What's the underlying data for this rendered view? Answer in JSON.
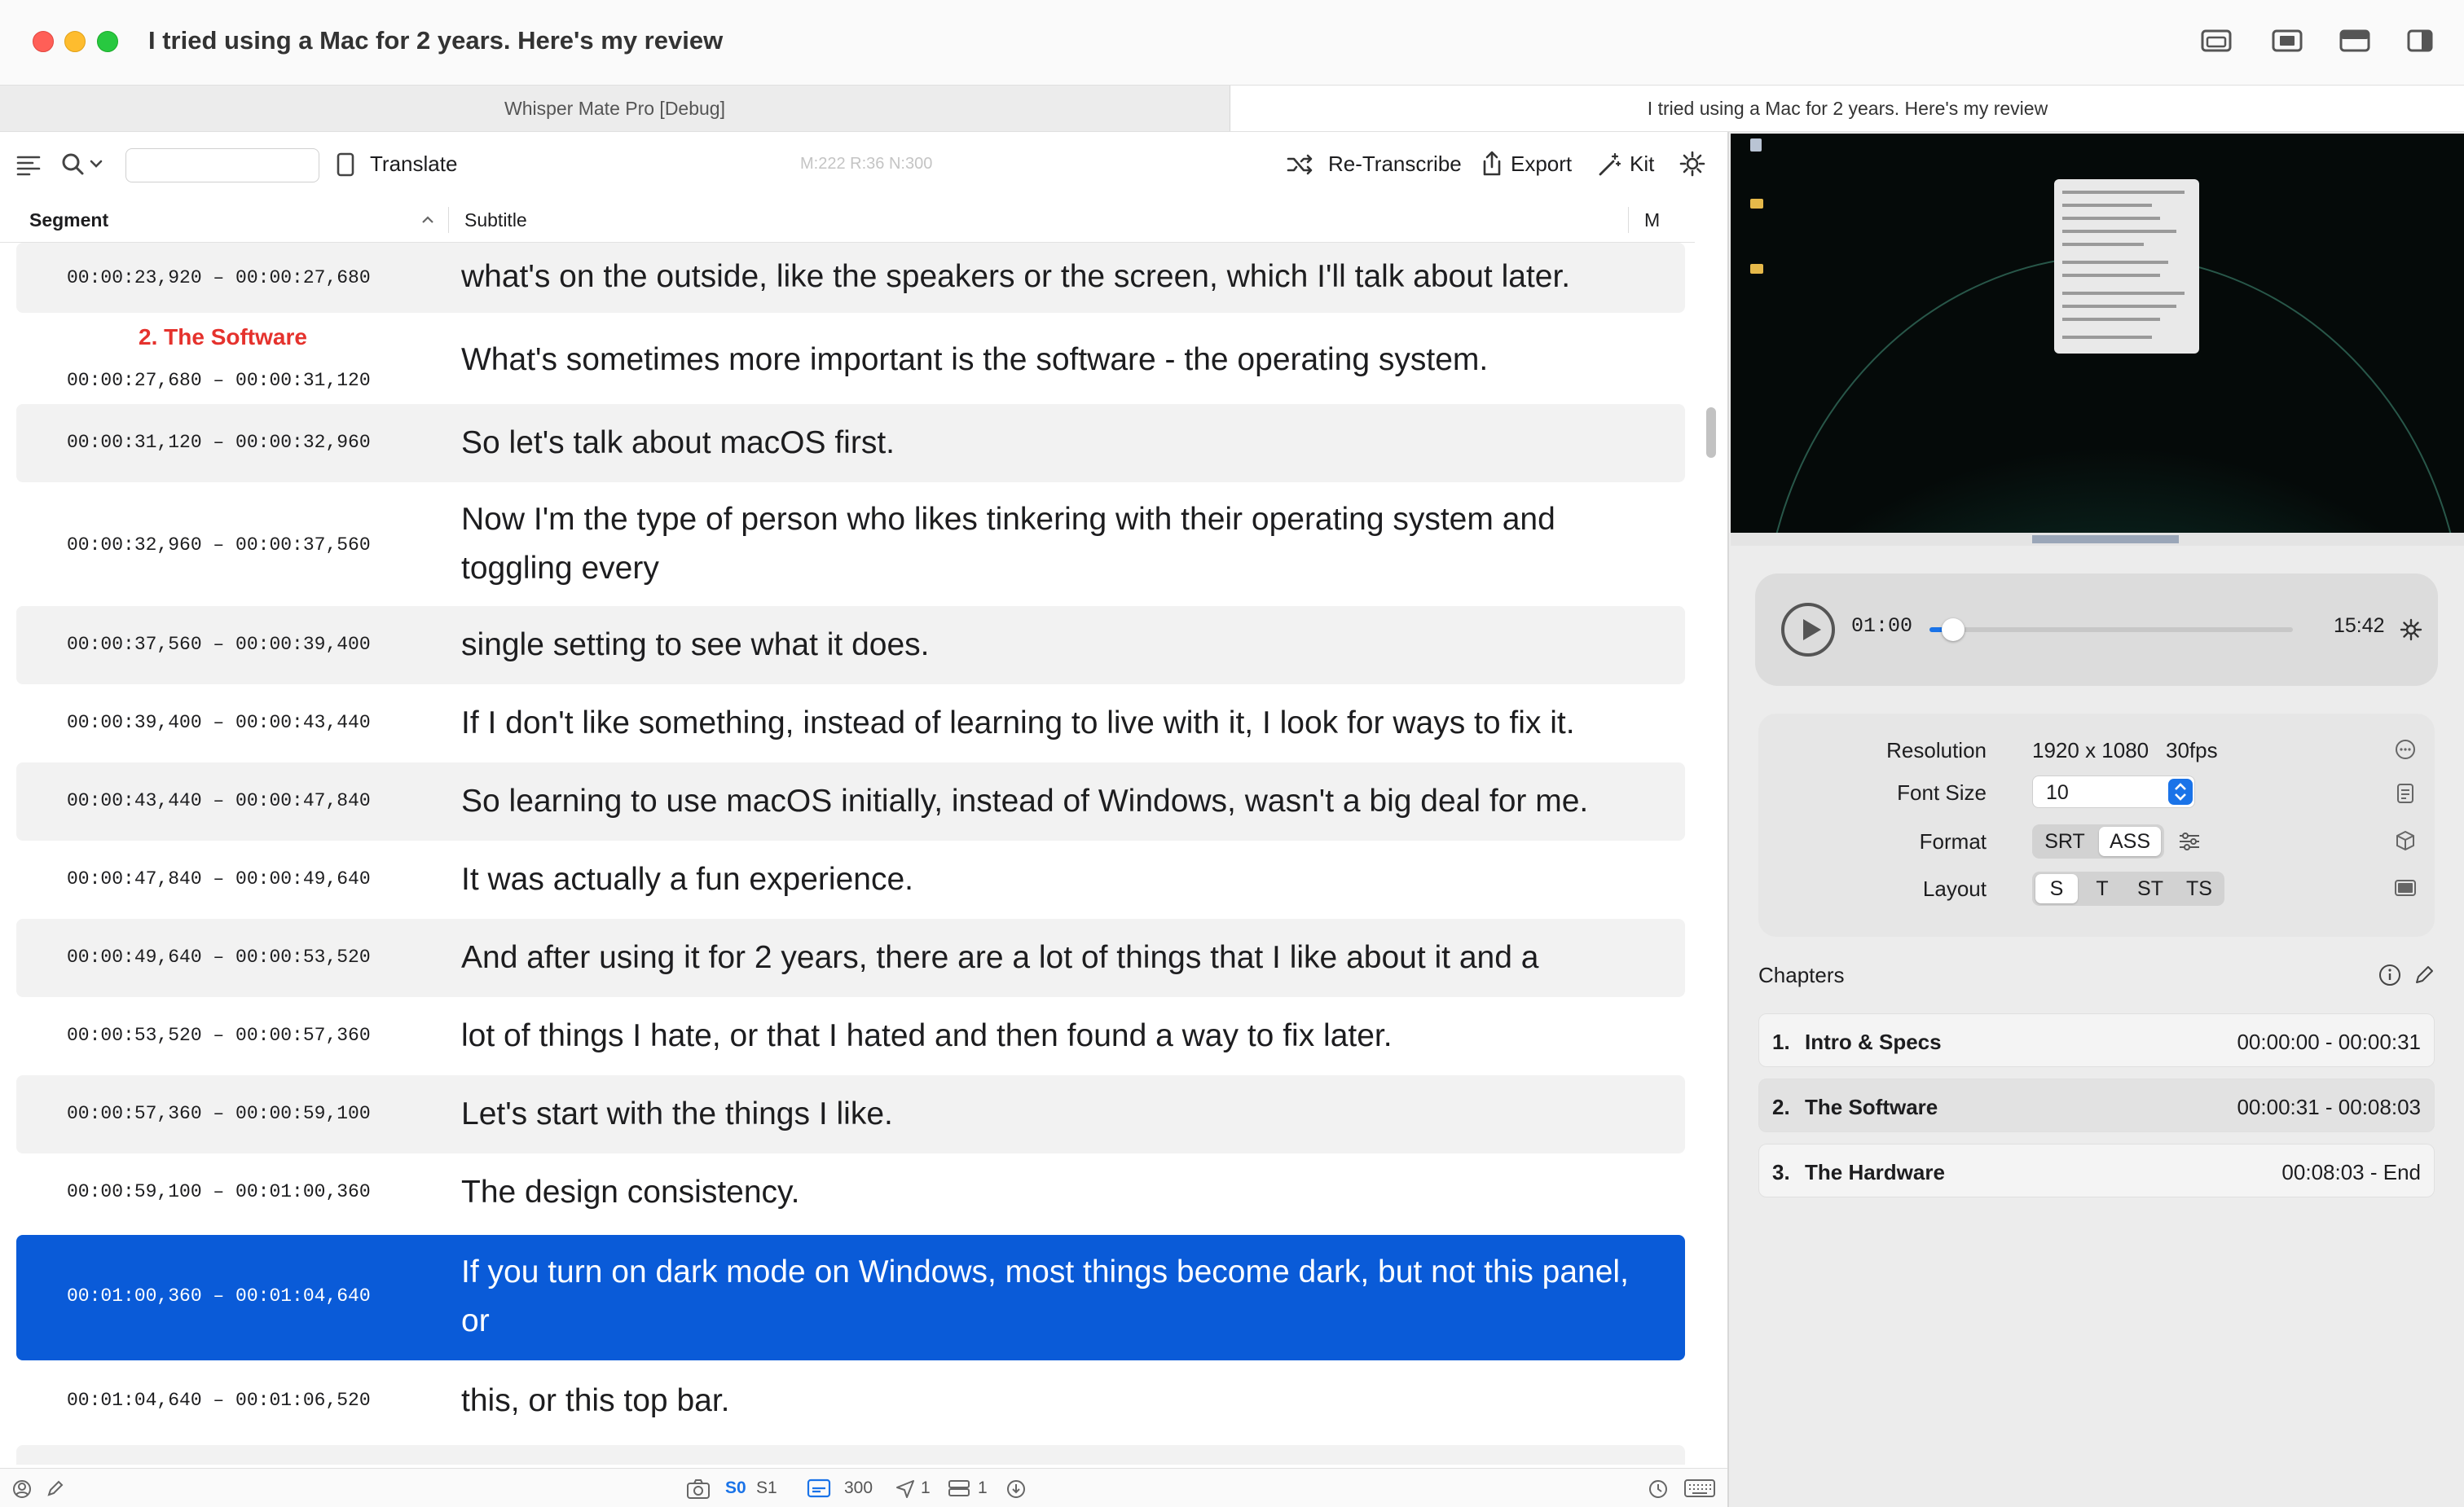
{
  "window": {
    "title": "I tried using a Mac for 2 years. Here's my review"
  },
  "tabs": [
    {
      "label": "Whisper Mate Pro [Debug]",
      "active": false
    },
    {
      "label": "I tried using a Mac for 2 years. Here's my review",
      "active": true
    }
  ],
  "toolbar": {
    "search_placeholder": "",
    "translate_label": "Translate",
    "stats": "M:222 R:36 N:300",
    "retranscribe_label": "Re-Transcribe",
    "export_label": "Export",
    "kit_label": "Kit"
  },
  "table": {
    "columns": {
      "segment": "Segment",
      "subtitle": "Subtitle",
      "m": "M"
    },
    "rows": [
      {
        "time": "00:00:23,920 – 00:00:27,680",
        "text": "what's on the outside, like the speakers or the screen, which I'll talk about later.",
        "chapter": ""
      },
      {
        "time": "00:00:27,680 – 00:00:31,120",
        "text": "What's sometimes more important is the software - the operating system.",
        "chapter": "2. The Software"
      },
      {
        "time": "00:00:31,120 – 00:00:32,960",
        "text": "So let's talk about macOS first.",
        "chapter": ""
      },
      {
        "time": "00:00:32,960 – 00:00:37,560",
        "text": "Now I'm the type of person who likes tinkering with their operating system and toggling every",
        "chapter": ""
      },
      {
        "time": "00:00:37,560 – 00:00:39,400",
        "text": "single setting to see what it does.",
        "chapter": ""
      },
      {
        "time": "00:00:39,400 – 00:00:43,440",
        "text": "If I don't like something, instead of learning to live with it, I look for ways to fix it.",
        "chapter": ""
      },
      {
        "time": "00:00:43,440 – 00:00:47,840",
        "text": "So learning to use macOS initially, instead of Windows, wasn't a big deal for me.",
        "chapter": ""
      },
      {
        "time": "00:00:47,840 – 00:00:49,640",
        "text": "It was actually a fun experience.",
        "chapter": ""
      },
      {
        "time": "00:00:49,640 – 00:00:53,520",
        "text": "And after using it for 2 years, there are a lot of things that I like about it and a",
        "chapter": ""
      },
      {
        "time": "00:00:53,520 – 00:00:57,360",
        "text": "lot of things I hate, or that I hated and then found a way to fix later.",
        "chapter": ""
      },
      {
        "time": "00:00:57,360 – 00:00:59,100",
        "text": "Let's start with the things I like.",
        "chapter": ""
      },
      {
        "time": "00:00:59,100 – 00:01:00,360",
        "text": "The design consistency.",
        "chapter": ""
      },
      {
        "time": "00:01:00,360 – 00:01:04,640",
        "text": "If you turn on dark mode on Windows, most things become dark, but not this panel, or",
        "chapter": ""
      },
      {
        "time": "00:01:04,640 – 00:01:06,520",
        "text": "this, or this top bar.",
        "chapter": ""
      }
    ]
  },
  "statusbar": {
    "s0": "S0",
    "s1": "S1",
    "count": "300",
    "sent": "1",
    "stack": "1"
  },
  "player": {
    "current": "01:00",
    "total": "15:42",
    "progress": 0.064
  },
  "settings": {
    "resolution_label": "Resolution",
    "resolution_value": "1920 x 1080",
    "fps_value": "30fps",
    "font_size_label": "Font Size",
    "font_size_value": "10",
    "format_label": "Format",
    "format_options": [
      "SRT",
      "ASS"
    ],
    "format_selected": "ASS",
    "layout_label": "Layout",
    "layout_options": [
      "S",
      "T",
      "ST",
      "TS"
    ],
    "layout_selected": "S"
  },
  "chapters": {
    "title": "Chapters",
    "items": [
      {
        "num": "1.",
        "name": "Intro & Specs",
        "time": "00:00:00 - 00:00:31"
      },
      {
        "num": "2.",
        "name": "The Software",
        "time": "00:00:31 - 00:08:03"
      },
      {
        "num": "3.",
        "name": "The Hardware",
        "time": "00:08:03 - End"
      }
    ]
  },
  "colors": {
    "accent": "#0a5bd8",
    "chapter_marker": "#e5322d",
    "close": "#ff5f57",
    "minimize": "#febc2e",
    "maximize": "#28c840"
  }
}
